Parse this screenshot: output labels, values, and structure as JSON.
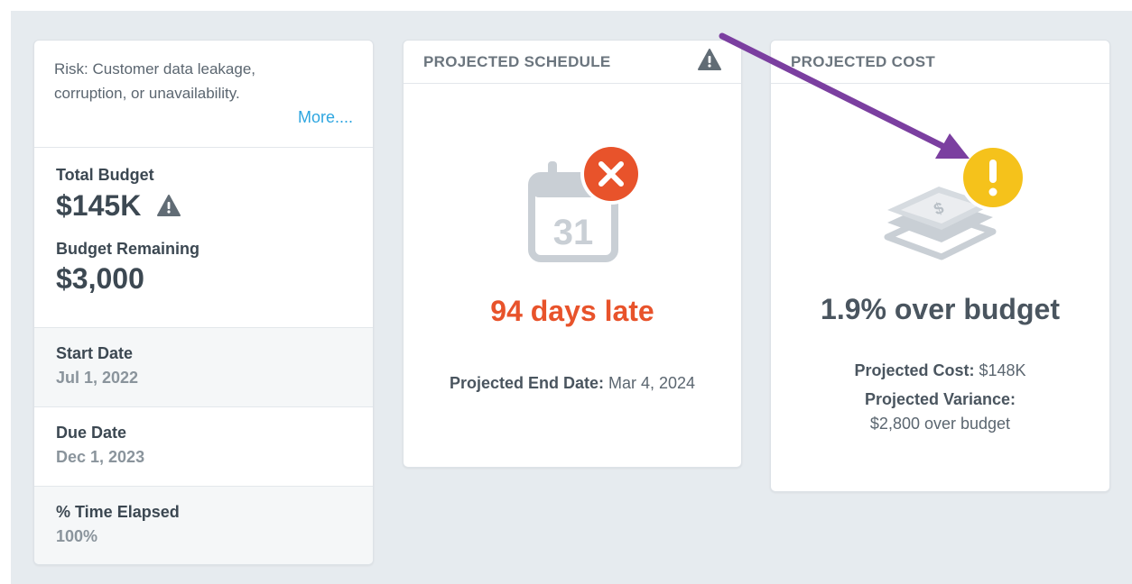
{
  "risk": {
    "text": "Risk: Customer data leakage, corruption, or unavailability.",
    "more_link": "More...."
  },
  "budget": {
    "total_label": "Total Budget",
    "total_value": "$145K",
    "remaining_label": "Budget Remaining",
    "remaining_value": "$3,000"
  },
  "dates": {
    "start_label": "Start Date",
    "start_value": "Jul 1, 2022",
    "due_label": "Due Date",
    "due_value": "Dec 1, 2023",
    "elapsed_label": "% Time Elapsed",
    "elapsed_value": "100%"
  },
  "schedule": {
    "header": "PROJECTED SCHEDULE",
    "calendar_day": "31",
    "headline": "94 days late",
    "end_date_label": "Projected End Date:",
    "end_date_value": "Mar 4, 2024"
  },
  "cost": {
    "header": "PROJECTED COST",
    "headline": "1.9% over budget",
    "projected_cost_label": "Projected Cost:",
    "projected_cost_value": "$148K",
    "variance_label": "Projected Variance:",
    "variance_value": "$2,800 over budget"
  },
  "colors": {
    "late_red": "#e8532b",
    "warning_yellow": "#f5c21b",
    "arrow_purple": "#7b3fa0"
  },
  "icons": [
    "warning-triangle-icon",
    "calendar-icon",
    "error-x-icon",
    "money-stack-icon",
    "exclamation-circle-icon"
  ]
}
